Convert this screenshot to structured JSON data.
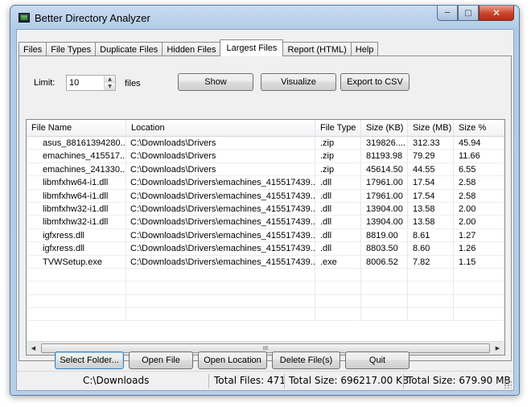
{
  "window": {
    "title": "Better Directory Analyzer",
    "icon": "app-window-icon"
  },
  "tabs": [
    "Files",
    "File Types",
    "Duplicate Files",
    "Hidden Files",
    "Largest Files",
    "Report (HTML)",
    "Help"
  ],
  "active_tab": "Largest Files",
  "controls": {
    "limit_label": "Limit:",
    "limit_value": "10",
    "files_label": "files",
    "show_label": "Show",
    "visualize_label": "Visualize",
    "export_label": "Export to CSV"
  },
  "grid": {
    "columns": [
      "File Name",
      "Location",
      "File Type",
      "Size (KB)",
      "Size (MB)",
      "Size %"
    ],
    "rows": [
      [
        "asus_88161394280...",
        "C:\\Downloads\\Drivers",
        ".zip",
        "319826....",
        "312.33",
        "45.94"
      ],
      [
        "emachines_415517...",
        "C:\\Downloads\\Drivers",
        ".zip",
        "81193.98",
        "79.29",
        "11.66"
      ],
      [
        "emachines_241330...",
        "C:\\Downloads\\Drivers",
        ".zip",
        "45614.50",
        "44.55",
        "6.55"
      ],
      [
        "libmfxhw64-i1.dll",
        "C:\\Downloads\\Drivers\\emachines_415517439...",
        ".dll",
        "17961.00",
        "17.54",
        "2.58"
      ],
      [
        "libmfxhw64-i1.dll",
        "C:\\Downloads\\Drivers\\emachines_415517439...",
        ".dll",
        "17961.00",
        "17.54",
        "2.58"
      ],
      [
        "libmfxhw32-i1.dll",
        "C:\\Downloads\\Drivers\\emachines_415517439...",
        ".dll",
        "13904.00",
        "13.58",
        "2.00"
      ],
      [
        "libmfxhw32-i1.dll",
        "C:\\Downloads\\Drivers\\emachines_415517439...",
        ".dll",
        "13904.00",
        "13.58",
        "2.00"
      ],
      [
        "igfxress.dll",
        "C:\\Downloads\\Drivers\\emachines_415517439...",
        ".dll",
        "8819.00",
        "8.61",
        "1.27"
      ],
      [
        "igfxress.dll",
        "C:\\Downloads\\Drivers\\emachines_415517439...",
        ".dll",
        "8803.50",
        "8.60",
        "1.26"
      ],
      [
        "TVWSetup.exe",
        "C:\\Downloads\\Drivers\\emachines_415517439...",
        ".exe",
        "8006.52",
        "7.82",
        "1.15"
      ]
    ],
    "scroll_thumb_glyph": "III"
  },
  "actions": {
    "select_folder": "Select Folder...",
    "open_file": "Open File",
    "open_location": "Open Location",
    "delete_files": "Delete File(s)",
    "quit": "Quit"
  },
  "status": {
    "path": "C:\\Downloads",
    "total_files": "Total Files: 471",
    "total_size_kb": "Total Size: 696217.00 KB",
    "total_size_mb": "Total Size: 679.90 MB"
  }
}
